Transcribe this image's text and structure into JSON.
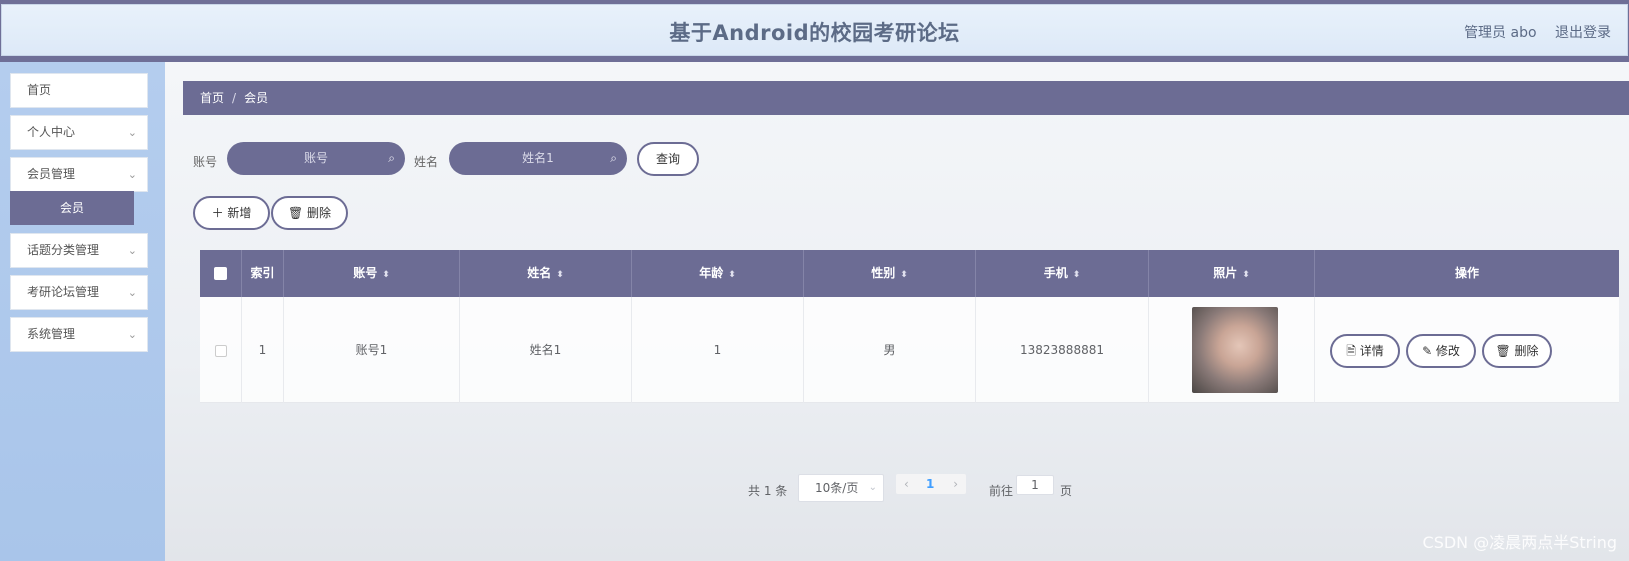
{
  "header": {
    "title": "基于Android的校园考研论坛",
    "user": "管理员 abo",
    "logout": "退出登录"
  },
  "sidebar": {
    "items": [
      {
        "label": "首页",
        "has_chevron": false
      },
      {
        "label": "个人中心",
        "has_chevron": true
      },
      {
        "label": "会员管理",
        "has_chevron": true
      },
      {
        "label": "话题分类管理",
        "has_chevron": true
      },
      {
        "label": "考研论坛管理",
        "has_chevron": true
      },
      {
        "label": "系统管理",
        "has_chevron": true
      }
    ],
    "active_sub": "会员",
    "chevron_glyph": "⌄"
  },
  "breadcrumb": {
    "home": "首页",
    "sep": "/",
    "current": "会员"
  },
  "search": {
    "account_label": "账号",
    "account_placeholder": "账号",
    "name_label": "姓名",
    "name_value": "姓名1",
    "query_button": "查询"
  },
  "actions": {
    "add": "＋ 新增",
    "delete": "🗑 删除"
  },
  "table": {
    "columns": [
      "",
      "索引",
      "账号",
      "姓名",
      "年龄",
      "性别",
      "手机",
      "照片",
      "操作"
    ],
    "sortable": [
      false,
      false,
      true,
      true,
      true,
      true,
      true,
      true,
      false
    ],
    "sort_glyph": "⬍",
    "rows": [
      {
        "index": "1",
        "account": "账号1",
        "name": "姓名1",
        "age": "1",
        "gender": "男",
        "phone": "13823888881"
      }
    ],
    "row_actions": {
      "detail": "🗎 详情",
      "edit": "✎ 修改",
      "delete": "🗑 删除"
    }
  },
  "pagination": {
    "total": "共 1 条",
    "page_size": "10条/页",
    "current_page": "1",
    "goto_label": "前往",
    "goto_value": "1",
    "page_suffix": "页",
    "prev": "‹",
    "next": "›",
    "dropdown_glyph": "⌄"
  },
  "icons": {
    "search": "⌕"
  },
  "watermark": "CSDN @凌晨两点半String",
  "colors": {
    "primary": "#6c6c94",
    "header_bg": "#e8f1fb",
    "sidebar_bg": "#b4cdee"
  }
}
